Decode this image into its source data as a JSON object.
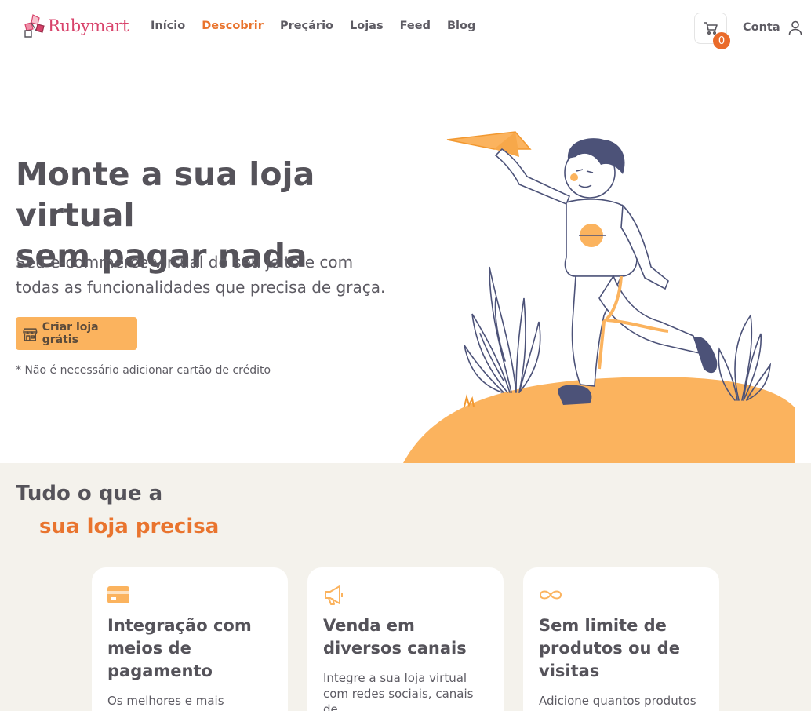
{
  "brand": {
    "name": "Rubymart",
    "color": "#d8436b"
  },
  "nav": {
    "items": [
      {
        "label": "Início",
        "active": false
      },
      {
        "label": "Descobrir",
        "active": true
      },
      {
        "label": "Preçário",
        "active": false
      },
      {
        "label": "Lojas",
        "active": false
      },
      {
        "label": "Feed",
        "active": false
      },
      {
        "label": "Blog",
        "active": false
      }
    ],
    "accent_color": "#e9742e"
  },
  "cart": {
    "icon": "cart-icon",
    "count": "0"
  },
  "account": {
    "label": "Conta",
    "icon": "user-icon"
  },
  "hero": {
    "title_line1": "Monte a sua loja virtual",
    "title_line2": "sem pagar nada",
    "subtitle_line1": "Seu e-commerce virtual do seu jeito e com",
    "subtitle_line2": "todas as funcionalidades que precisa de graça.",
    "cta_label": "Criar loja grátis",
    "cta_icon": "store-icon",
    "cta_color": "#fbb35e",
    "note": "* Não é necessário adicionar cartão de crédito"
  },
  "features": {
    "title": "Tudo o que a",
    "title_accent": "sua loja precisa",
    "background": "#f4f2ec",
    "cards": [
      {
        "icon": "credit-card-icon",
        "title": "Integração com meios de pagamento",
        "text": "Os melhores e mais"
      },
      {
        "icon": "megaphone-icon",
        "title": "Venda em diversos canais",
        "text": "Integre a sua loja virtual com redes sociais, canais de"
      },
      {
        "icon": "infinity-icon",
        "title": "Sem limite de produtos ou de visitas",
        "text": "Adicione quantos produtos"
      }
    ]
  }
}
